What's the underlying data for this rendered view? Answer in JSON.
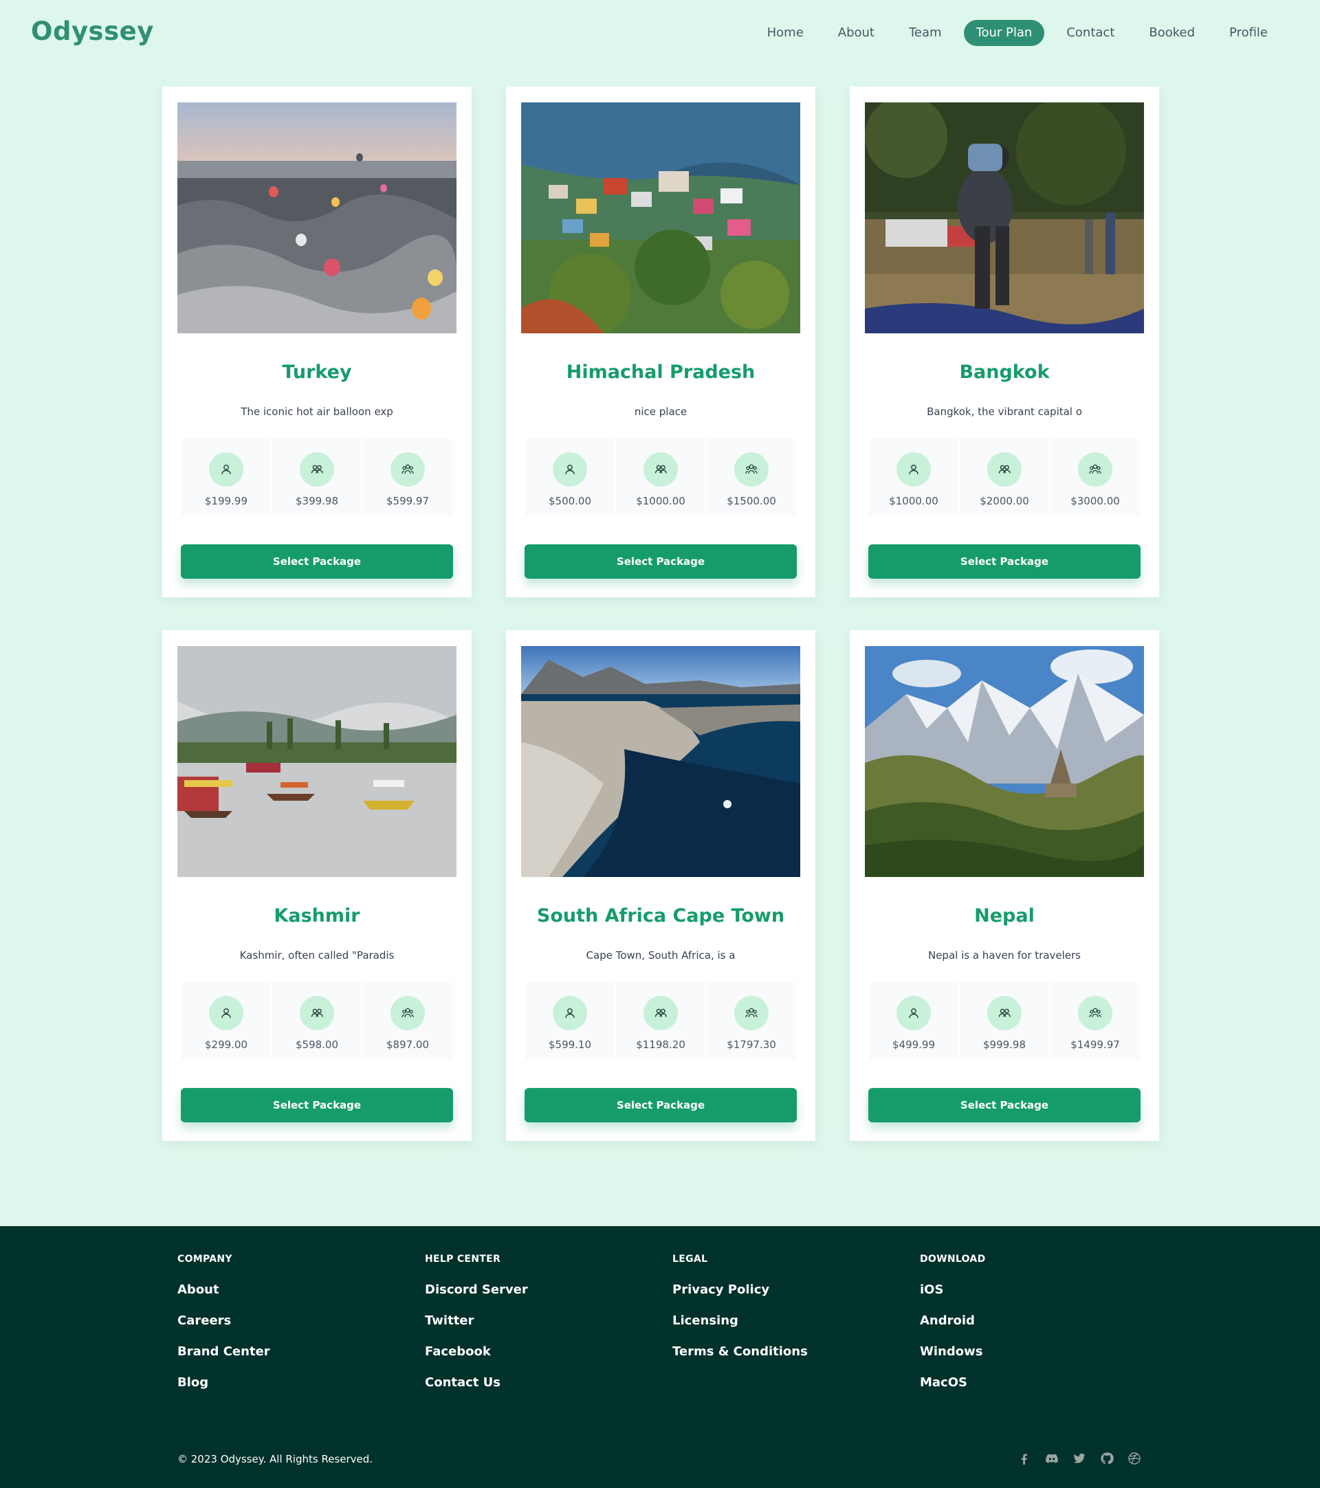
{
  "brand": {
    "name": "Odyssey"
  },
  "nav": {
    "items": [
      {
        "label": "Home"
      },
      {
        "label": "About"
      },
      {
        "label": "Team"
      },
      {
        "label": "Tour Plan"
      },
      {
        "label": "Contact"
      },
      {
        "label": "Booked"
      },
      {
        "label": "Profile"
      }
    ],
    "active": "Tour Plan"
  },
  "button_label": "Select Package",
  "packages": [
    {
      "title": "Turkey",
      "desc": "The iconic hot air balloon exp",
      "prices": [
        "$199.99",
        "$399.98",
        "$599.97"
      ],
      "image": "hot-air-balloons-over-rocky-valley"
    },
    {
      "title": "Himachal Pradesh",
      "desc": "nice place",
      "prices": [
        "$500.00",
        "$1000.00",
        "$1500.00"
      ],
      "image": "mountain-village-with-colorful-houses"
    },
    {
      "title": "Bangkok",
      "desc": "Bangkok, the vibrant capital o",
      "prices": [
        "$1000.00",
        "$2000.00",
        "$3000.00"
      ],
      "image": "person-with-paraglider-gear-in-field"
    },
    {
      "title": "Kashmir",
      "desc": "Kashmir, often called \"Paradis",
      "prices": [
        "$299.00",
        "$598.00",
        "$897.00"
      ],
      "image": "shikara-boats-on-lake"
    },
    {
      "title": "South Africa Cape Town",
      "desc": "Cape Town, South Africa, is a",
      "prices": [
        "$599.10",
        "$1198.20",
        "$1797.30"
      ],
      "image": "aerial-coastal-city-and-ocean"
    },
    {
      "title": "Nepal",
      "desc": "Nepal is a haven for travelers",
      "prices": [
        "$499.99",
        "$999.98",
        "$1499.97"
      ],
      "image": "snow-mountains-and-stupa"
    }
  ],
  "price_icons": [
    "single-person-icon",
    "two-people-icon",
    "group-icon"
  ],
  "footer": {
    "columns": [
      {
        "heading": "COMPANY",
        "links": [
          "About",
          "Careers",
          "Brand Center",
          "Blog"
        ]
      },
      {
        "heading": "HELP CENTER",
        "links": [
          "Discord Server",
          "Twitter",
          "Facebook",
          "Contact Us"
        ]
      },
      {
        "heading": "LEGAL",
        "links": [
          "Privacy Policy",
          "Licensing",
          "Terms & Conditions"
        ]
      },
      {
        "heading": "DOWNLOAD",
        "links": [
          "iOS",
          "Android",
          "Windows",
          "MacOS"
        ]
      }
    ],
    "copyright": "© 2023 Odyssey. All Rights Reserved.",
    "socials": [
      "facebook-icon",
      "discord-icon",
      "twitter-icon",
      "github-icon",
      "dribbble-icon"
    ]
  },
  "colors": {
    "background": "#def7ec",
    "brand": "#2f8f74",
    "accent": "#169c6b",
    "footer": "#00312a"
  }
}
